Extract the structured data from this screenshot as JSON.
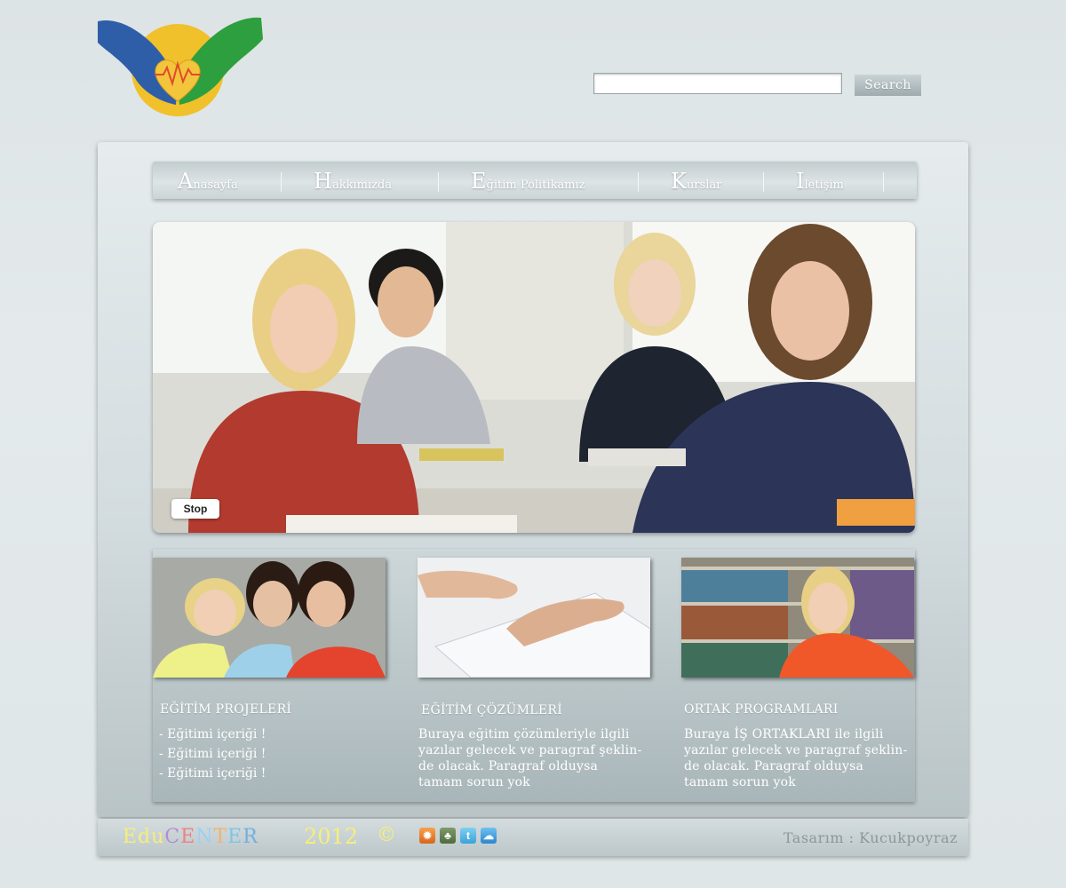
{
  "search": {
    "placeholder": "",
    "button_label": "Search"
  },
  "nav": {
    "items": [
      {
        "cap": "A",
        "rest": "nasayfa"
      },
      {
        "cap": "H",
        "rest": "akkımızda"
      },
      {
        "cap": "E",
        "rest": "ğitim Politikamız"
      },
      {
        "cap": "K",
        "rest": "urslar"
      },
      {
        "cap": "I",
        "rest": "letişim"
      }
    ]
  },
  "hero": {
    "stop_label": "Stop"
  },
  "columns": [
    {
      "title": "EĞİTİM PROJELERİ",
      "items": [
        "- Eğitimi içeriği !",
        "- Eğitimi içeriği !",
        "- Eğitimi içeriği !"
      ]
    },
    {
      "title": "EĞİTİM ÇÖZÜMLERİ",
      "text_lines": [
        "Buraya eğitim çözümleriyle ilgili",
        "yazılar gelecek ve paragraf şeklin-",
        "de olacak. Paragraf olduysa",
        "tamam sorun yok"
      ]
    },
    {
      "title": "ORTAK PROGRAMLARI",
      "text_lines": [
        "Buraya İŞ ORTAKLARI ile ilgili",
        "yazılar gelecek ve paragraf şeklin-",
        "de olacak. Paragraf olduysa",
        "tamam sorun yok"
      ]
    }
  ],
  "footer": {
    "brand_parts": [
      "Edu",
      "C",
      "E",
      "N",
      "T",
      "E",
      "R"
    ],
    "year": "2012",
    "copyright": "©",
    "credit": "Tasarım : Kucukpoyraz",
    "social_icons": [
      "fire-icon",
      "evernote-icon",
      "twitter-icon",
      "cloud-icon"
    ]
  },
  "colors": {
    "panel": "#d3dcdf",
    "nav_text": "#ffffff",
    "brand_yellow": "#f6ef7a"
  }
}
